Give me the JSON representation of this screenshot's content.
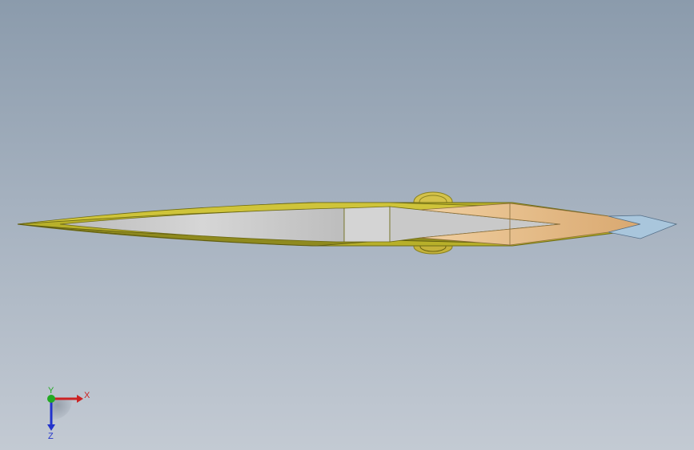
{
  "viewport": {
    "background_top": "#8b9bac",
    "background_bottom": "#c3cad3"
  },
  "model": {
    "name": "",
    "colors": {
      "edge_olive": "#b8b833",
      "edge_dark": "#7a7a1a",
      "body_grey": "#c8c8c8",
      "tip_tan": "#e6c08c",
      "tip_blue": "#a9c6dc"
    }
  },
  "triad": {
    "x_label": "X",
    "y_label": "Y",
    "z_label": "Z",
    "x_color": "#cc2222",
    "y_color": "#22aa22",
    "z_color": "#2233cc"
  }
}
